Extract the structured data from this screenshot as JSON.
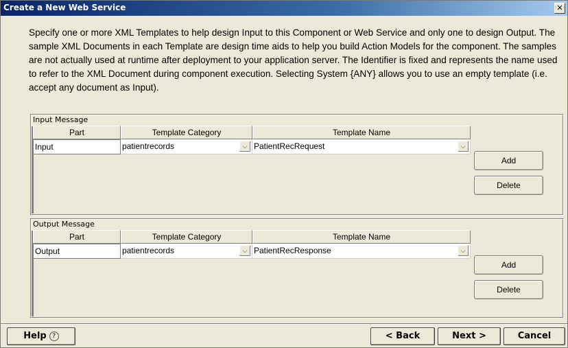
{
  "window": {
    "title": "Create a New Web Service",
    "close_glyph": "✕"
  },
  "description": "Specify one or more XML Templates to help design Input to this Component or Web Service and only one to design Output.  The sample XML Documents in each Template are design time aids to help you build Action Models for the component.  The samples are not actually used at runtime after deployment to your application server.  The Identifier is fixed and represents the name used to refer to the XML Document during component execution.  Selecting System {ANY} allows you to use an empty template (i.e. accept any document as Input).",
  "columns": [
    "Part",
    "Template Category",
    "Template Name"
  ],
  "input": {
    "label": "Input Message",
    "rows": [
      {
        "part": "Input",
        "category": "patientrecords",
        "name": "PatientRecRequest"
      }
    ],
    "add_label": "Add",
    "delete_label": "Delete"
  },
  "output": {
    "label": "Output Message",
    "rows": [
      {
        "part": "Output",
        "category": "patientrecords",
        "name": "PatientRecResponse"
      }
    ],
    "add_label": "Add",
    "delete_label": "Delete"
  },
  "footer": {
    "help_label": "Help",
    "help_icon": "?",
    "back_label": "< Back",
    "next_label": "Next >",
    "cancel_label": "Cancel"
  },
  "icons": {
    "dropdown": "chevron-down-icon",
    "help": "question-circle-icon",
    "close": "close-icon"
  }
}
